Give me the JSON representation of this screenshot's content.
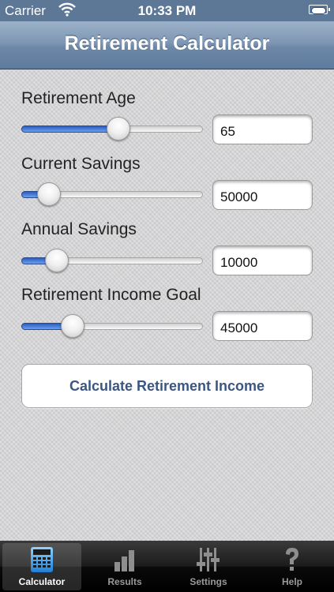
{
  "status_bar": {
    "carrier": "Carrier",
    "time": "10:33 PM"
  },
  "nav": {
    "title": "Retirement Calculator"
  },
  "fields": [
    {
      "label": "Retirement Age",
      "value": "65",
      "slider_fraction": 0.54
    },
    {
      "label": "Current Savings",
      "value": "50000",
      "slider_fraction": 0.1
    },
    {
      "label": "Annual Savings",
      "value": "10000",
      "slider_fraction": 0.15
    },
    {
      "label": "Retirement Income Goal",
      "value": "45000",
      "slider_fraction": 0.25
    }
  ],
  "calculate_button": {
    "label": "Calculate Retirement Income"
  },
  "tabs": [
    {
      "label": "Calculator",
      "icon": "calculator-icon",
      "active": true
    },
    {
      "label": "Results",
      "icon": "bar-chart-icon",
      "active": false
    },
    {
      "label": "Settings",
      "icon": "sliders-icon",
      "active": false
    },
    {
      "label": "Help",
      "icon": "question-mark-icon",
      "active": false
    }
  ],
  "colors": {
    "nav_bar": "#7f97b4",
    "slider_fill": "#3d74d6",
    "button_text": "#3a5683"
  }
}
